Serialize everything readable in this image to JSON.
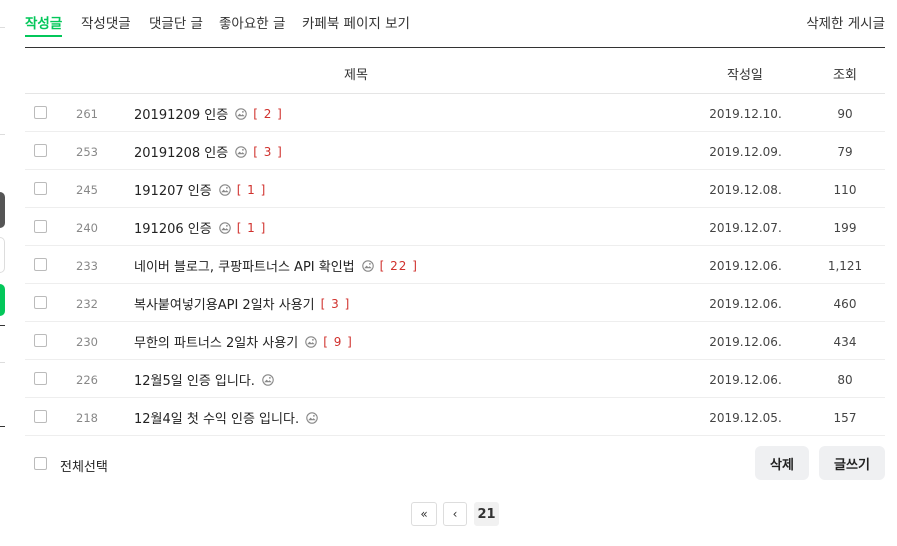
{
  "tabs": {
    "items": [
      {
        "label": "작성글",
        "active": true
      },
      {
        "label": "작성댓글",
        "active": false
      },
      {
        "label": "댓글단 글",
        "active": false
      },
      {
        "label": "좋아요한 글",
        "active": false
      },
      {
        "label": "카페북 페이지 보기",
        "active": false
      }
    ],
    "deleted_posts": "삭제한 게시글"
  },
  "table": {
    "columns": {
      "title": "제목",
      "date": "작성일",
      "views": "조회"
    },
    "rows": [
      {
        "num": "261",
        "title": "20191209 인증",
        "has_image": true,
        "comments": "[ 2 ]",
        "date": "2019.12.10.",
        "views": "90"
      },
      {
        "num": "253",
        "title": "20191208 인증",
        "has_image": true,
        "comments": "[ 3 ]",
        "date": "2019.12.09.",
        "views": "79"
      },
      {
        "num": "245",
        "title": "191207 인증",
        "has_image": true,
        "comments": "[ 1 ]",
        "date": "2019.12.08.",
        "views": "110"
      },
      {
        "num": "240",
        "title": "191206 인증",
        "has_image": true,
        "comments": "[ 1 ]",
        "date": "2019.12.07.",
        "views": "199"
      },
      {
        "num": "233",
        "title": "네이버 블로그, 쿠팡파트너스 API 확인법",
        "has_image": true,
        "comments": "[ 22 ]",
        "date": "2019.12.06.",
        "views": "1,121"
      },
      {
        "num": "232",
        "title": "복사붙여넣기용API 2일차 사용기",
        "has_image": false,
        "comments": "[ 3 ]",
        "date": "2019.12.06.",
        "views": "460"
      },
      {
        "num": "230",
        "title": "무한의 파트너스 2일차 사용기",
        "has_image": true,
        "comments": "[ 9 ]",
        "date": "2019.12.06.",
        "views": "434"
      },
      {
        "num": "226",
        "title": "12월5일 인증 입니다.",
        "has_image": true,
        "comments": "",
        "date": "2019.12.06.",
        "views": "80"
      },
      {
        "num": "218",
        "title": "12월4일 첫 수익 인증 입니다.",
        "has_image": true,
        "comments": "",
        "date": "2019.12.05.",
        "views": "157"
      }
    ]
  },
  "footer": {
    "select_all": "전체선택",
    "delete_button": "삭제",
    "write_button": "글쓰기"
  },
  "pagination": {
    "first": "«",
    "prev": "‹",
    "current": "21"
  },
  "colors": {
    "accent": "#03c75a",
    "comment_count": "#d0312d"
  },
  "icons": {
    "image_attached": "image-icon"
  }
}
